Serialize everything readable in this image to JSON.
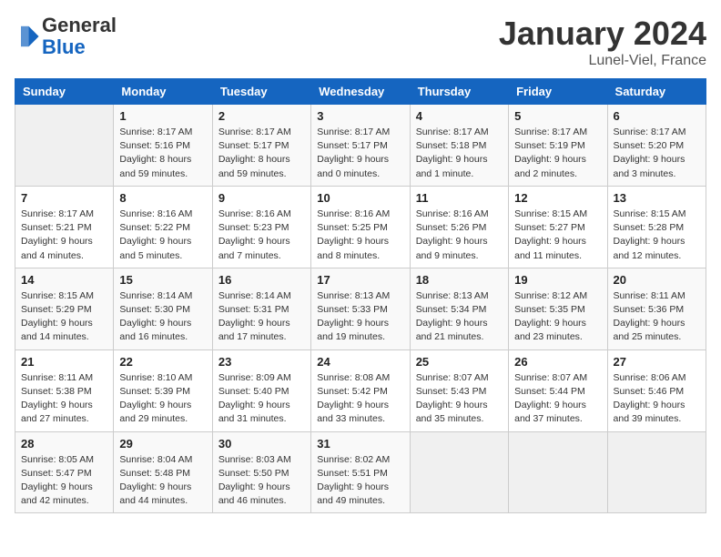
{
  "header": {
    "logo_general": "General",
    "logo_blue": "Blue",
    "month_title": "January 2024",
    "location": "Lunel-Viel, France"
  },
  "days_of_week": [
    "Sunday",
    "Monday",
    "Tuesday",
    "Wednesday",
    "Thursday",
    "Friday",
    "Saturday"
  ],
  "weeks": [
    [
      {
        "day": "",
        "info": ""
      },
      {
        "day": "1",
        "info": "Sunrise: 8:17 AM\nSunset: 5:16 PM\nDaylight: 8 hours\nand 59 minutes."
      },
      {
        "day": "2",
        "info": "Sunrise: 8:17 AM\nSunset: 5:17 PM\nDaylight: 8 hours\nand 59 minutes."
      },
      {
        "day": "3",
        "info": "Sunrise: 8:17 AM\nSunset: 5:17 PM\nDaylight: 9 hours\nand 0 minutes."
      },
      {
        "day": "4",
        "info": "Sunrise: 8:17 AM\nSunset: 5:18 PM\nDaylight: 9 hours\nand 1 minute."
      },
      {
        "day": "5",
        "info": "Sunrise: 8:17 AM\nSunset: 5:19 PM\nDaylight: 9 hours\nand 2 minutes."
      },
      {
        "day": "6",
        "info": "Sunrise: 8:17 AM\nSunset: 5:20 PM\nDaylight: 9 hours\nand 3 minutes."
      }
    ],
    [
      {
        "day": "7",
        "info": "Sunrise: 8:17 AM\nSunset: 5:21 PM\nDaylight: 9 hours\nand 4 minutes."
      },
      {
        "day": "8",
        "info": "Sunrise: 8:16 AM\nSunset: 5:22 PM\nDaylight: 9 hours\nand 5 minutes."
      },
      {
        "day": "9",
        "info": "Sunrise: 8:16 AM\nSunset: 5:23 PM\nDaylight: 9 hours\nand 7 minutes."
      },
      {
        "day": "10",
        "info": "Sunrise: 8:16 AM\nSunset: 5:25 PM\nDaylight: 9 hours\nand 8 minutes."
      },
      {
        "day": "11",
        "info": "Sunrise: 8:16 AM\nSunset: 5:26 PM\nDaylight: 9 hours\nand 9 minutes."
      },
      {
        "day": "12",
        "info": "Sunrise: 8:15 AM\nSunset: 5:27 PM\nDaylight: 9 hours\nand 11 minutes."
      },
      {
        "day": "13",
        "info": "Sunrise: 8:15 AM\nSunset: 5:28 PM\nDaylight: 9 hours\nand 12 minutes."
      }
    ],
    [
      {
        "day": "14",
        "info": "Sunrise: 8:15 AM\nSunset: 5:29 PM\nDaylight: 9 hours\nand 14 minutes."
      },
      {
        "day": "15",
        "info": "Sunrise: 8:14 AM\nSunset: 5:30 PM\nDaylight: 9 hours\nand 16 minutes."
      },
      {
        "day": "16",
        "info": "Sunrise: 8:14 AM\nSunset: 5:31 PM\nDaylight: 9 hours\nand 17 minutes."
      },
      {
        "day": "17",
        "info": "Sunrise: 8:13 AM\nSunset: 5:33 PM\nDaylight: 9 hours\nand 19 minutes."
      },
      {
        "day": "18",
        "info": "Sunrise: 8:13 AM\nSunset: 5:34 PM\nDaylight: 9 hours\nand 21 minutes."
      },
      {
        "day": "19",
        "info": "Sunrise: 8:12 AM\nSunset: 5:35 PM\nDaylight: 9 hours\nand 23 minutes."
      },
      {
        "day": "20",
        "info": "Sunrise: 8:11 AM\nSunset: 5:36 PM\nDaylight: 9 hours\nand 25 minutes."
      }
    ],
    [
      {
        "day": "21",
        "info": "Sunrise: 8:11 AM\nSunset: 5:38 PM\nDaylight: 9 hours\nand 27 minutes."
      },
      {
        "day": "22",
        "info": "Sunrise: 8:10 AM\nSunset: 5:39 PM\nDaylight: 9 hours\nand 29 minutes."
      },
      {
        "day": "23",
        "info": "Sunrise: 8:09 AM\nSunset: 5:40 PM\nDaylight: 9 hours\nand 31 minutes."
      },
      {
        "day": "24",
        "info": "Sunrise: 8:08 AM\nSunset: 5:42 PM\nDaylight: 9 hours\nand 33 minutes."
      },
      {
        "day": "25",
        "info": "Sunrise: 8:07 AM\nSunset: 5:43 PM\nDaylight: 9 hours\nand 35 minutes."
      },
      {
        "day": "26",
        "info": "Sunrise: 8:07 AM\nSunset: 5:44 PM\nDaylight: 9 hours\nand 37 minutes."
      },
      {
        "day": "27",
        "info": "Sunrise: 8:06 AM\nSunset: 5:46 PM\nDaylight: 9 hours\nand 39 minutes."
      }
    ],
    [
      {
        "day": "28",
        "info": "Sunrise: 8:05 AM\nSunset: 5:47 PM\nDaylight: 9 hours\nand 42 minutes."
      },
      {
        "day": "29",
        "info": "Sunrise: 8:04 AM\nSunset: 5:48 PM\nDaylight: 9 hours\nand 44 minutes."
      },
      {
        "day": "30",
        "info": "Sunrise: 8:03 AM\nSunset: 5:50 PM\nDaylight: 9 hours\nand 46 minutes."
      },
      {
        "day": "31",
        "info": "Sunrise: 8:02 AM\nSunset: 5:51 PM\nDaylight: 9 hours\nand 49 minutes."
      },
      {
        "day": "",
        "info": ""
      },
      {
        "day": "",
        "info": ""
      },
      {
        "day": "",
        "info": ""
      }
    ]
  ]
}
